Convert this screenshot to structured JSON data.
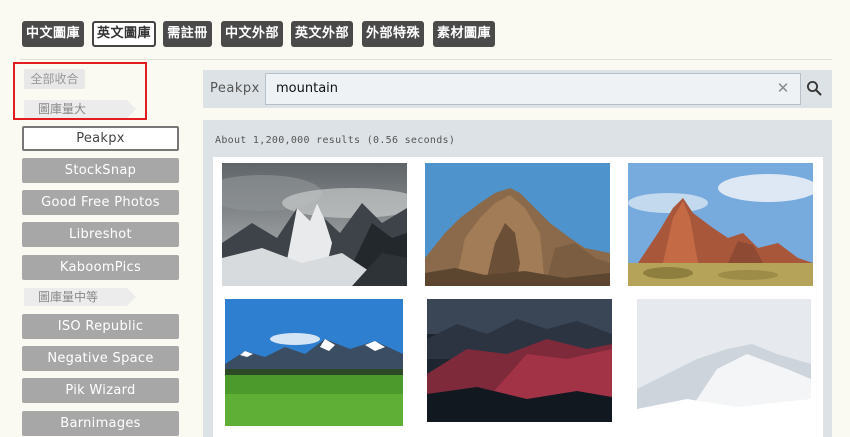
{
  "tabs": [
    {
      "label": "中文圖庫",
      "active": false
    },
    {
      "label": "英文圖庫",
      "active": true
    },
    {
      "label": "需註冊",
      "active": false
    },
    {
      "label": "中文外部",
      "active": false
    },
    {
      "label": "英文外部",
      "active": false
    },
    {
      "label": "外部特殊",
      "active": false
    },
    {
      "label": "素材圖庫",
      "active": false
    }
  ],
  "sidebar": {
    "collapse_all": "全部收合",
    "group_large": "圖庫量大",
    "group_medium": "圖庫量中等",
    "sources_large": [
      "Peakpx",
      "StockSnap",
      "Good Free Photos",
      "Libreshot",
      "KaboomPics"
    ],
    "sources_medium": [
      "ISO Republic",
      "Negative Space",
      "Pik Wizard",
      "Barnimages"
    ],
    "active_source": "Peakpx"
  },
  "search": {
    "engine": "Peakpx",
    "query": "mountain",
    "clear_icon": "close-icon",
    "submit_icon": "search-icon"
  },
  "results": {
    "stats": "About 1,200,000 results (0.56 seconds)",
    "images": [
      "mountain-peaks-clouds",
      "rocky-outcrop-blue-sky",
      "red-rock-formation-desert",
      "green-meadow-snowy-mountains",
      "dark-mountain-range-red-light",
      "misty-snowy-mountain-slope"
    ]
  },
  "colors": {
    "tab_bg": "#4a4a4a",
    "source_btn": "#a7a7a7",
    "highlight_box": "#e21d1d",
    "search_panel": "#dde2e6"
  }
}
